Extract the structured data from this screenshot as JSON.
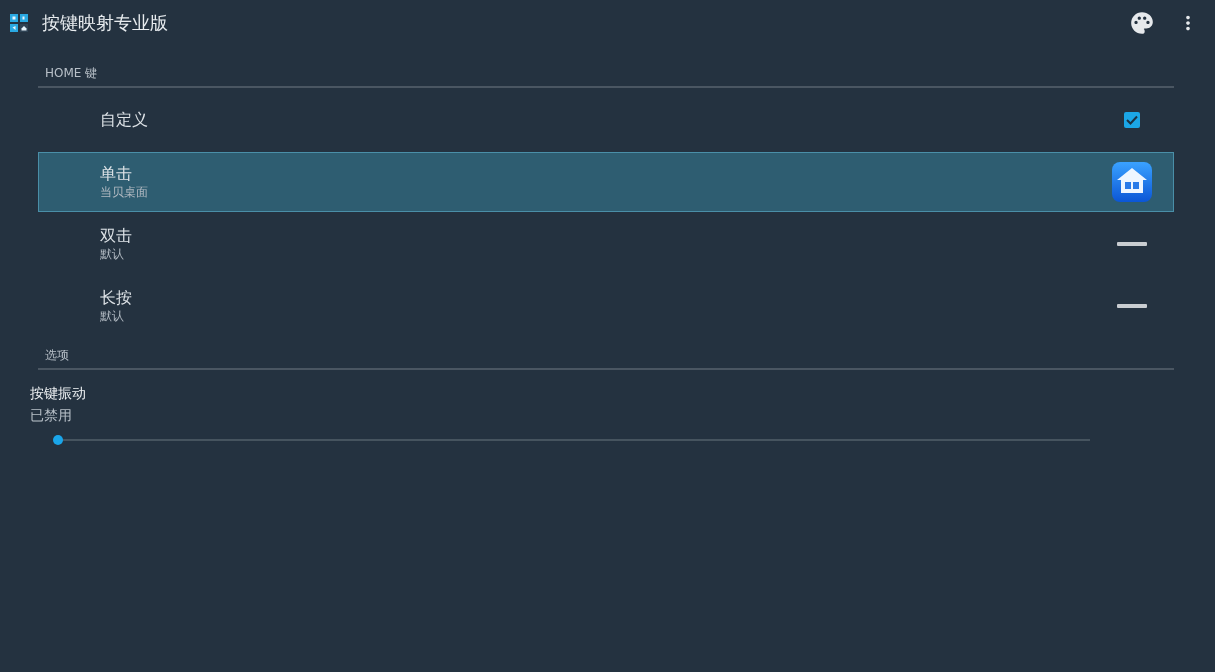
{
  "app_bar": {
    "title": "按键映射专业版"
  },
  "sections": [
    {
      "header": "HOME 键",
      "items": [
        {
          "kind": "checkbox",
          "title": "自定义",
          "checked": true,
          "selected": false
        },
        {
          "kind": "app",
          "title": "单击",
          "summary": "当贝桌面",
          "selected": true
        },
        {
          "kind": "none",
          "title": "双击",
          "summary": "默认",
          "selected": false
        },
        {
          "kind": "none",
          "title": "长按",
          "summary": "默认",
          "selected": false
        }
      ]
    },
    {
      "header": "选项",
      "items": [
        {
          "kind": "slider",
          "title": "按键振动",
          "summary": "已禁用",
          "level": 0
        }
      ]
    }
  ]
}
